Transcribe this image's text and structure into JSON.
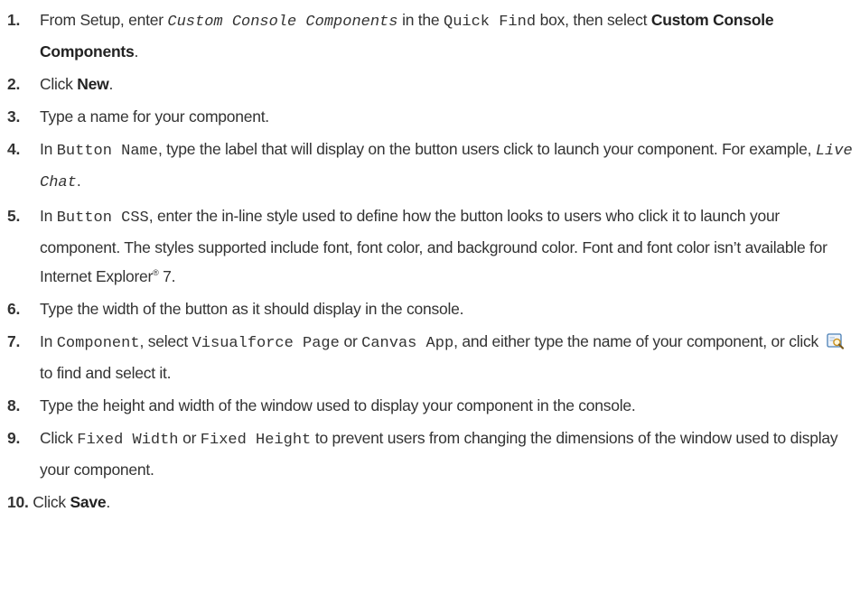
{
  "steps": [
    {
      "num": "1.",
      "t1": "From Setup, enter ",
      "c1": "Custom Console Components",
      "t2": " in the ",
      "c2": "Quick Find",
      "t3": " box, then select ",
      "b1": "Custom Console Components",
      "t4": "."
    },
    {
      "num": "2.",
      "t1": "Click ",
      "b1": "New",
      "t2": "."
    },
    {
      "num": "3.",
      "t1": "Type a name for your component."
    },
    {
      "num": "4.",
      "t1": "In ",
      "c1": "Button Name",
      "t2": ", type the label that will display on the button users click to launch your component. For example, ",
      "c2": "Live Chat",
      "t3": "."
    },
    {
      "num": "5.",
      "t1": "In ",
      "c1": "Button CSS",
      "t2": ", enter the in-line style used to define how the button looks to users who click it to launch your component. The styles supported include font, font color, and background color. Font and font color isn’t available for Internet Explorer",
      "sup": "®",
      "t3": " 7."
    },
    {
      "num": "6.",
      "t1": "Type the width of the button as it should display in the console."
    },
    {
      "num": "7.",
      "t1": "In ",
      "c1": "Component",
      "t2": ", select ",
      "c2": "Visualforce Page",
      "t3": " or ",
      "c3": "Canvas App",
      "t4": ", and either type the name of your component, or click ",
      "t5": " to find and select it."
    },
    {
      "num": "8.",
      "t1": "Type the height and width of the window used to display your component in the console."
    },
    {
      "num": "9.",
      "t1": "Click ",
      "c1": "Fixed Width",
      "t2": " or ",
      "c2": "Fixed Height",
      "t3": " to prevent users from changing the dimensions of the window used to display your component."
    },
    {
      "num": "10.",
      "t1": "Click ",
      "b1": "Save",
      "t2": "."
    }
  ],
  "icons": {
    "lookup": "lookup-magnifier-icon"
  },
  "colors": {
    "text": "#333333",
    "icon_frame": "#4a7fb5",
    "icon_fill": "#eef4fb",
    "icon_lens": "#f2c14e"
  }
}
